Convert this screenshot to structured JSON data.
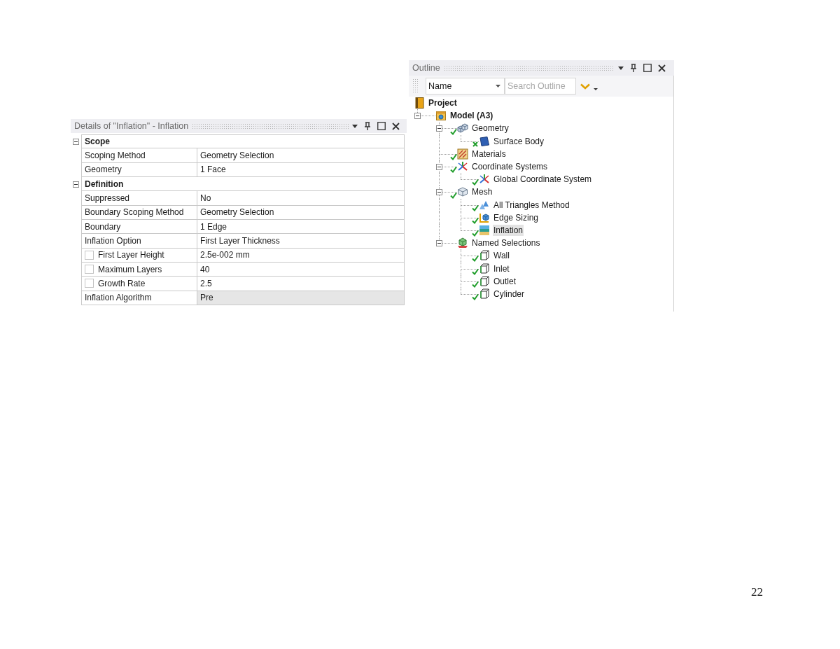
{
  "details": {
    "title": "Details of \"Inflation\" - Inflation",
    "sections": [
      {
        "label": "Scope",
        "expanded": true,
        "rows": [
          {
            "kind": "property",
            "label": "Scoping Method",
            "value": "Geometry Selection",
            "selected": false
          },
          {
            "kind": "property",
            "label": "Geometry",
            "value": "1 Face",
            "selected": false
          }
        ]
      },
      {
        "label": "Definition",
        "expanded": true,
        "rows": [
          {
            "kind": "property",
            "label": "Suppressed",
            "value": "No",
            "selected": false
          },
          {
            "kind": "property",
            "label": "Boundary Scoping Method",
            "value": "Geometry Selection",
            "selected": false
          },
          {
            "kind": "property",
            "label": "Boundary",
            "value": "1 Edge",
            "selected": false
          },
          {
            "kind": "property",
            "label": "Inflation Option",
            "value": "First Layer Thickness",
            "selected": false
          },
          {
            "kind": "parameter",
            "label": "First Layer Height",
            "value": "2.5e-002 mm",
            "selected": false,
            "checked": false
          },
          {
            "kind": "parameter",
            "label": "Maximum Layers",
            "value": "40",
            "selected": false,
            "checked": false
          },
          {
            "kind": "parameter",
            "label": "Growth Rate",
            "value": "2.5",
            "selected": false,
            "checked": false
          },
          {
            "kind": "property",
            "label": "Inflation Algorithm",
            "value": "Pre",
            "selected": true
          }
        ]
      }
    ]
  },
  "outline": {
    "title": "Outline",
    "filter": "Name",
    "search": {
      "placeholder": "Search Outline"
    },
    "tree": [
      {
        "label": "Project",
        "kind": "project",
        "selected": false,
        "children": [
          {
            "label": "Model (A3)",
            "kind": "model",
            "selected": false,
            "expanded": true,
            "children": [
              {
                "label": "Geometry",
                "kind": "geometry",
                "valid": true,
                "selected": false,
                "expanded": true,
                "children": [
                  {
                    "label": "Surface Body",
                    "kind": "body",
                    "valid": false,
                    "selected": false
                  }
                ]
              },
              {
                "label": "Materials",
                "kind": "materials",
                "valid": true,
                "selected": false
              },
              {
                "label": "Coordinate Systems",
                "kind": "coordinate-systems",
                "valid": true,
                "selected": false,
                "expanded": true,
                "children": [
                  {
                    "label": "Global Coordinate System",
                    "kind": "coordinate-system",
                    "valid": true,
                    "selected": false
                  }
                ]
              },
              {
                "label": "Mesh",
                "kind": "mesh",
                "valid": true,
                "selected": false,
                "expanded": true,
                "children": [
                  {
                    "label": "All Triangles Method",
                    "kind": "mesh-method",
                    "valid": true,
                    "selected": false
                  },
                  {
                    "label": "Edge Sizing",
                    "kind": "sizing",
                    "valid": true,
                    "selected": false
                  },
                  {
                    "label": "Inflation",
                    "kind": "inflation",
                    "valid": true,
                    "selected": true
                  }
                ]
              },
              {
                "label": "Named Selections",
                "kind": "named-selections",
                "selected": false,
                "expanded": true,
                "children": [
                  {
                    "label": "Wall",
                    "kind": "named-selection",
                    "valid": true,
                    "selected": false
                  },
                  {
                    "label": "Inlet",
                    "kind": "named-selection",
                    "valid": true,
                    "selected": false
                  },
                  {
                    "label": "Outlet",
                    "kind": "named-selection",
                    "valid": true,
                    "selected": false
                  },
                  {
                    "label": "Cylinder",
                    "kind": "named-selection",
                    "valid": true,
                    "selected": false
                  }
                ]
              }
            ]
          }
        ]
      }
    ]
  },
  "page_number": "22"
}
